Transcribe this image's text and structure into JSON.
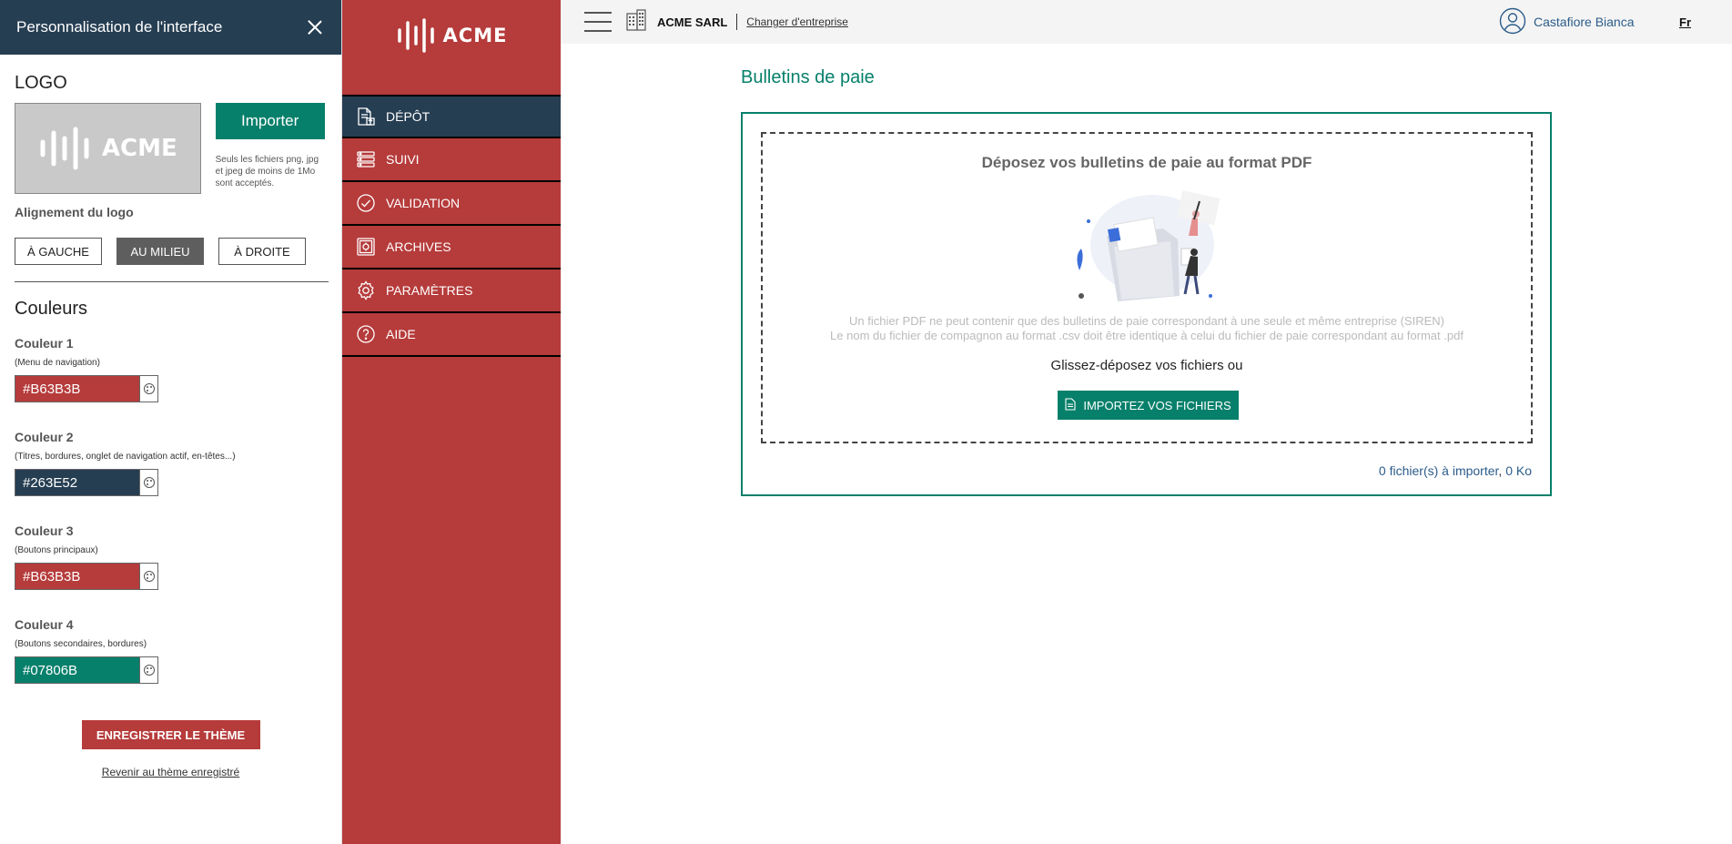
{
  "panel": {
    "title": "Personnalisation de l'interface",
    "logo_heading": "LOGO",
    "logo_word": "ACME",
    "import_label": "Importer",
    "import_hint": "Seuls les fichiers png, jpg et jpeg de moins de 1Mo sont acceptés.",
    "align_label": "Alignement du logo",
    "align_options": [
      "À GAUCHE",
      "AU MILIEU",
      "À DROITE"
    ],
    "align_selected": "AU MILIEU",
    "colors_heading": "Couleurs",
    "colors": [
      {
        "name": "Couleur 1",
        "desc": "(Menu de navigation)",
        "value": "#B63B3B"
      },
      {
        "name": "Couleur 2",
        "desc": "(Titres, bordures, onglet de navigation actif, en-têtes...)",
        "value": "#263E52"
      },
      {
        "name": "Couleur 3",
        "desc": "(Boutons principaux)",
        "value": "#B63B3B"
      },
      {
        "name": "Couleur 4",
        "desc": "(Boutons secondaires, bordures)",
        "value": "#07806B"
      }
    ],
    "save_label": "ENREGISTRER LE THÈME",
    "revert_label": "Revenir au thème enregistré"
  },
  "nav": {
    "logo_word": "ACME",
    "items": [
      {
        "label": "DÉPÔT",
        "icon": "document-upload-icon",
        "active": true
      },
      {
        "label": "SUIVI",
        "icon": "list-icon",
        "active": false
      },
      {
        "label": "VALIDATION",
        "icon": "check-circle-icon",
        "active": false
      },
      {
        "label": "ARCHIVES",
        "icon": "safe-icon",
        "active": false
      },
      {
        "label": "PARAMÈTRES",
        "icon": "gear-icon",
        "active": false
      },
      {
        "label": "AIDE",
        "icon": "help-icon",
        "active": false
      }
    ]
  },
  "header": {
    "company": "ACME SARL",
    "change_company": "Changer d'entreprise",
    "user_name": "Castafiore Bianca",
    "language": "Fr"
  },
  "main": {
    "title": "Bulletins de paie",
    "dropzone_title": "Déposez vos bulletins de paie au format PDF",
    "note_line1": "Un fichier PDF ne peut contenir que des bulletins de paie correspondant à une seule et même entreprise (SIREN)",
    "note_line2": "Le nom du fichier de compagnon au format .csv doit être identique à celui du fichier de paie correspondant au format .pdf",
    "drag_text": "Glissez-déposez vos fichiers ou",
    "import_files_label": "IMPORTEZ VOS FICHIERS",
    "count_text": "0 fichier(s) à importer",
    "separator": ", ",
    "size_text": "0 Ko"
  },
  "colors": {
    "nav": "#B63B3B",
    "active": "#263E52",
    "primary": "#B63B3B",
    "secondary": "#07806B"
  }
}
